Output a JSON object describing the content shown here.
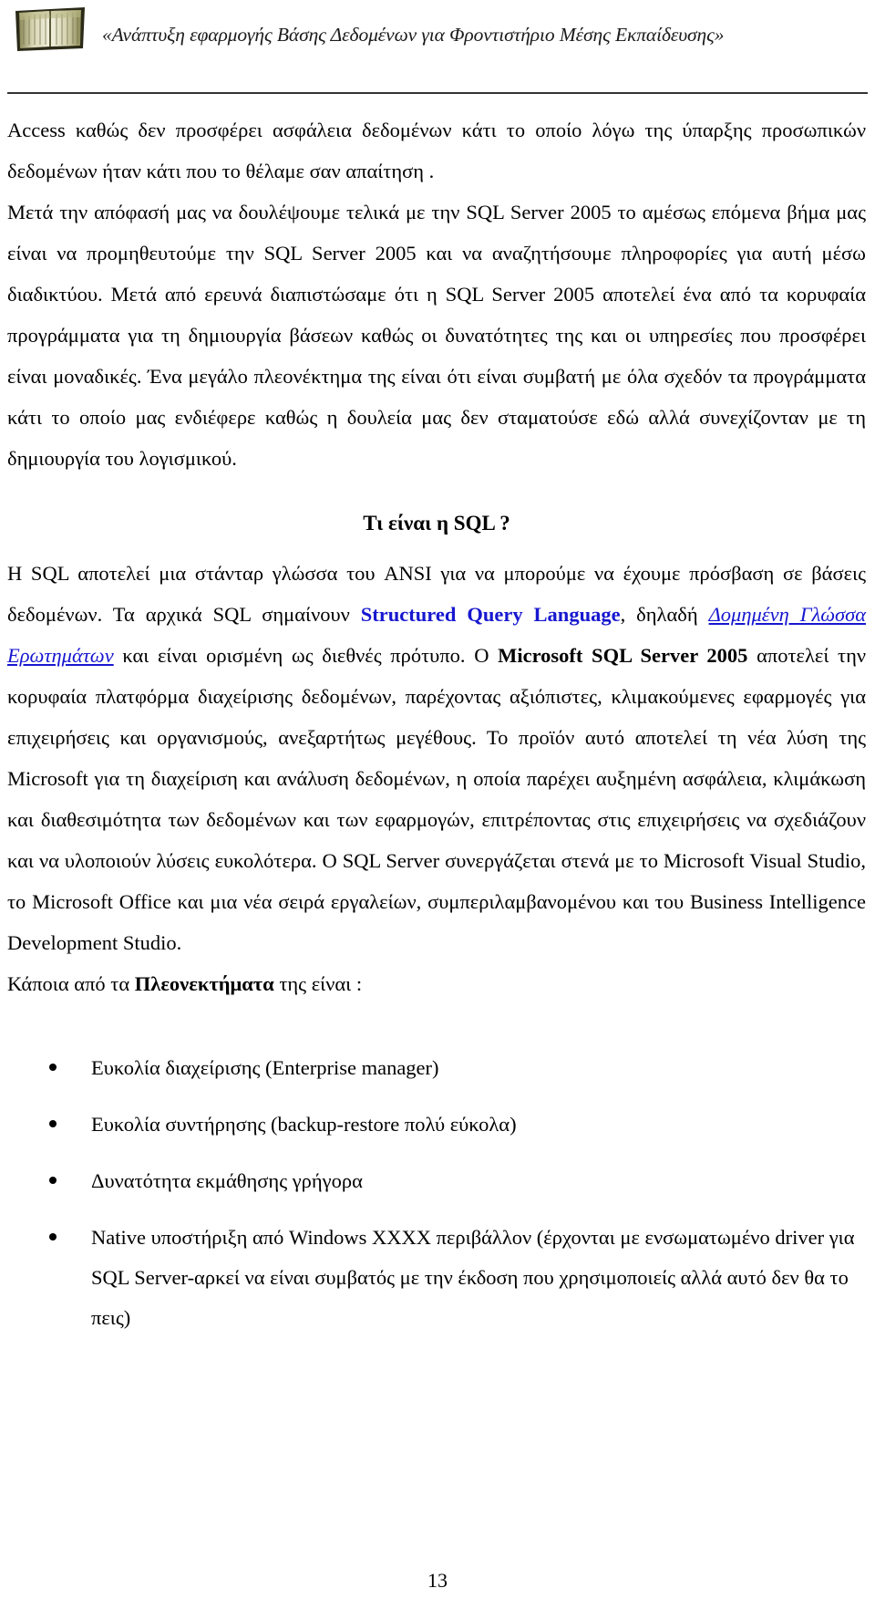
{
  "header": {
    "icon": "open-book-icon",
    "title": "«Ανάπτυξη εφαρμογής Βάσης Δεδομένων για Φροντιστήριο Μέσης Εκπαίδευσης»"
  },
  "body": {
    "paragraph_1": "Access καθώς δεν προσφέρει ασφάλεια δεδομένων κάτι το οποίο λόγω της ύπαρξης προσωπικών δεδομένων ήταν κάτι που το θέλαμε σαν απαίτηση .",
    "paragraph_2": "Μετά την απόφασή μας να δουλέψουμε τελικά με την SQL Server 2005 το αμέσως επόμενα βήμα μας είναι να προμηθευτούμε την SQL Server 2005 και να αναζητήσουμε πληροφορίες για αυτή μέσω διαδικτύου. Μετά από ερευνά διαπιστώσαμε ότι η SQL Server 2005  αποτελεί ένα από τα κορυφαία προγράμματα για τη δημιουργία βάσεων καθώς οι δυνατότητες της και οι υπηρεσίες που προσφέρει είναι μοναδικές. Ένα μεγάλο πλεονέκτημα της είναι ότι είναι συμβατή με όλα σχεδόν τα προγράμματα κάτι το οποίο  μας ενδιέφερε καθώς  η δουλεία μας δεν σταματούσε εδώ αλλά συνεχίζονταν με τη δημιουργία του λογισμικού.",
    "section_title": "Τι είναι η SQL ?",
    "paragraph_3_part1": "Η SQL αποτελεί μια στάνταρ γλώσσα του ANSI για να μπορούμε να έχουμε πρόσβαση σε βάσεις δεδομένων. Τα αρχικά SQL σημαίνουν ",
    "paragraph_3_highlight1": "Structured Query Language",
    "paragraph_3_part2": ", δηλαδή ",
    "paragraph_3_highlight2": "Δομημένη Γλώσσα Ερωτημάτων",
    "paragraph_3_part3": "  και είναι ορισμένη ως διεθνές πρότυπο. Ο ",
    "paragraph_3_highlight3": "Microsoft SQL Server 2005",
    "paragraph_3_part4": " αποτελεί την κορυφαία πλατφόρμα διαχείρισης δεδομένων, παρέχοντας αξιόπιστες, κλιμακούμενες εφαρμογές για επιχειρήσεις και οργανισμούς, ανεξαρτήτως μεγέθους. Το προϊόν αυτό αποτελεί τη νέα λύση της Microsoft για τη διαχείριση και ανάλυση δεδομένων, η οποία παρέχει αυξημένη ασφάλεια, κλιμάκωση και διαθεσιμότητα των δεδομένων και των εφαρμογών, επιτρέποντας στις επιχειρήσεις να σχεδιάζουν και να υλοποιούν λύσεις ευκολότερα. Ο SQL Server συνεργάζεται στενά με το Microsoft Visual Studio, το Microsoft Office και μια νέα σειρά εργαλείων, συμπεριλαμβανομένου και του Business Intelligence Development Studio.",
    "paragraph_4_part1": "Κάποια από τα ",
    "paragraph_4_highlight": "Πλεονεκτήματα",
    "paragraph_4_part2": " της είναι :"
  },
  "bullets": [
    "Ευκολία διαχείρισης (Enterprise manager)",
    "Ευκολία συντήρησης (backup-restore πολύ εύκολα)",
    "Δυνατότητα εκμάθησης γρήγορα",
    "Native υποστήριξη από Windows XXXX περιβάλλον (έρχονται με ενσωματωμένο driver για SQL Server-αρκεί να είναι συμβατός με την έκδοση που χρησιμοποιείς αλλά αυτό δεν θα το πεις)"
  ],
  "footer": {
    "page_number": "13"
  },
  "colors": {
    "accent_blue": "#1717d0",
    "text": "#000000",
    "rule": "#333333"
  }
}
